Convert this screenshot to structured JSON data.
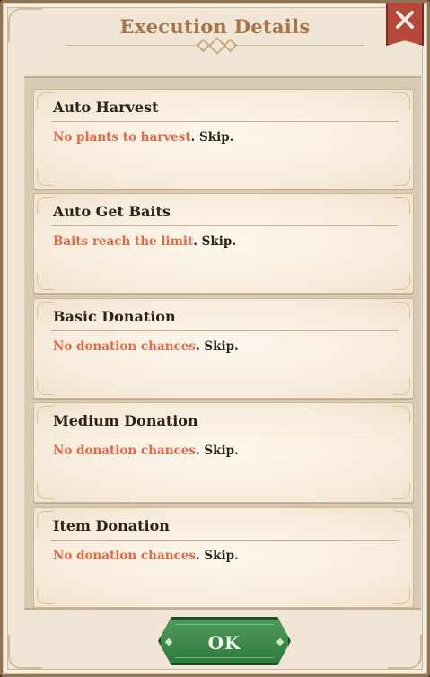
{
  "dialog": {
    "title": "Execution Details",
    "ok_label": "OK"
  },
  "close_icon": "close-icon",
  "tasks": [
    {
      "name": "Auto Harvest",
      "reason": "No plants to harvest",
      "result": ". Skip."
    },
    {
      "name": "Auto Get Baits",
      "reason": "Baits reach the limit",
      "result": ". Skip."
    },
    {
      "name": "Basic Donation",
      "reason": "No donation chances",
      "result": ". Skip."
    },
    {
      "name": "Medium Donation",
      "reason": "No donation chances",
      "result": ". Skip."
    },
    {
      "name": "Item Donation",
      "reason": "No donation chances",
      "result": ". Skip."
    }
  ],
  "colors": {
    "title": "#a4764a",
    "warning_text": "#e06a45",
    "ok_button": "#3e8a4b",
    "close_button": "#b6473b"
  }
}
